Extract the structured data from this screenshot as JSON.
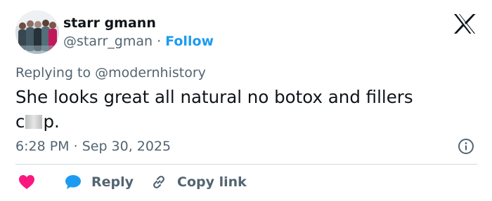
{
  "header": {
    "display_name": "starr gmann",
    "handle": "@starr_gman",
    "separator": " · ",
    "follow_label": "Follow"
  },
  "tweet": {
    "replying_prefix": "Replying to ",
    "replying_to": "@modernhistory",
    "text_line1": "She looks great all natural no botox and fillers",
    "text_censor_start": "c",
    "text_censor_end": "p.",
    "time": "6:28 PM",
    "time_separator": " · ",
    "date": "Sep 30, 2025"
  },
  "actions": {
    "reply_label": "Reply",
    "copy_link_label": "Copy link"
  },
  "colors": {
    "accent": "#1d9bf0",
    "like": "#f91880",
    "muted": "#536471",
    "text": "#0f1419",
    "divider": "#cfd9de"
  },
  "icons": {
    "logo": "x-logo-icon",
    "info": "info-icon",
    "like": "heart-icon",
    "reply": "speech-bubble-icon",
    "copy": "link-icon"
  }
}
